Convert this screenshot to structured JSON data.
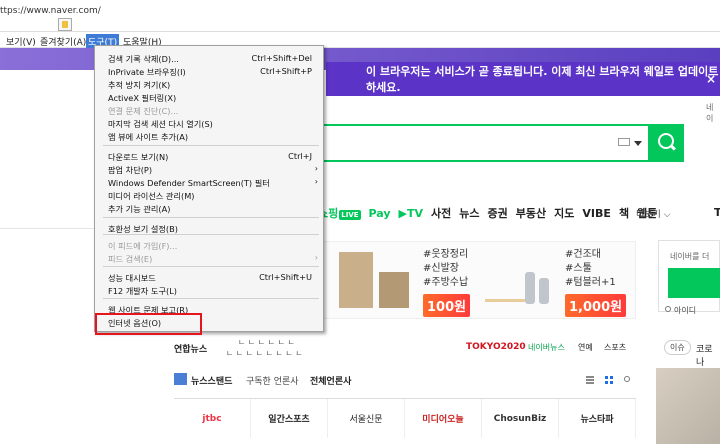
{
  "browser": {
    "url": "ttps://www.naver.com/",
    "menu": [
      "보기(V)",
      "즐겨찾기(A)",
      "도구(T)",
      "도움말(H)"
    ]
  },
  "banner": {
    "message": "이 브라우저는 서비스가 곧 종료됩니다. 이제 최신 브라우저 웨일로 업데이트하세요.",
    "close": "×"
  },
  "sublink": "네이",
  "nav": {
    "items": [
      "쇼핑",
      "Pay",
      "TV",
      "사전",
      "뉴스",
      "증권",
      "부동산",
      "지도",
      "VIBE",
      "책",
      "웹툰"
    ],
    "live": "LIVE",
    "more": "더보기 ⌵",
    "tail": "T"
  },
  "ad": {
    "tags1": [
      "#웃장정리",
      "#신발장",
      "#주방수납"
    ],
    "price1": "100원",
    "tags2": [
      "#건조대",
      "#스툴",
      "#텀블러+1"
    ],
    "price2": "1,000원"
  },
  "login": {
    "text": "네이버를 더",
    "id_link": "아이디"
  },
  "newsstrip": {
    "source": "연합뉴스",
    "headline1": "ㄴ ㄴ ㄴ ㄴ ㄴ ㄴ",
    "headline2": "ㄴ ㄴ ㄴ ㄴ ㄴ ㄴ ㄴ ㄴ",
    "tokyo": "TOKYO2020",
    "links": [
      "네이버뉴스",
      "연예",
      "스포츠"
    ],
    "pill": "이슈",
    "pill_text": "코로나"
  },
  "newsstand": {
    "title": "뉴스스탠드",
    "subscribed": "구독한 언론사",
    "all": "전체언론사",
    "press": [
      "jtbc",
      "일간스포츠",
      "서울신문",
      "미디어오늘",
      "ChosunBiz",
      "뉴스타파"
    ]
  },
  "dropdown": {
    "items": [
      {
        "label": "검색 기록 삭제(D)...",
        "shortcut": "Ctrl+Shift+Del",
        "disabled": false,
        "arrow": false
      },
      {
        "label": "InPrivate 브라우징(I)",
        "shortcut": "Ctrl+Shift+P",
        "disabled": false,
        "arrow": false
      },
      {
        "label": "추적 방지 켜기(K)",
        "shortcut": "",
        "disabled": false,
        "arrow": false
      },
      {
        "label": "ActiveX 필터링(X)",
        "shortcut": "",
        "disabled": false,
        "arrow": false
      },
      {
        "label": "연결 문제 진단(C)...",
        "shortcut": "",
        "disabled": true,
        "arrow": false
      },
      {
        "label": "마지막 검색 세션 다시 열기(S)",
        "shortcut": "",
        "disabled": false,
        "arrow": false
      },
      {
        "label": "앱 뷰에 사이트 추가(A)",
        "shortcut": "",
        "disabled": false,
        "arrow": false
      },
      {
        "label": "다운로드 보기(N)",
        "shortcut": "Ctrl+J",
        "disabled": false,
        "arrow": false
      },
      {
        "label": "팝업 차단(P)",
        "shortcut": "",
        "disabled": false,
        "arrow": true
      },
      {
        "label": "Windows Defender SmartScreen(T) 필터",
        "shortcut": "",
        "disabled": false,
        "arrow": true
      },
      {
        "label": "미디어 라이선스 관리(M)",
        "shortcut": "",
        "disabled": false,
        "arrow": false
      },
      {
        "label": "추가 기능 관리(A)",
        "shortcut": "",
        "disabled": false,
        "arrow": false
      },
      {
        "label": "호환성 보기 설정(B)",
        "shortcut": "",
        "disabled": false,
        "arrow": false
      },
      {
        "label": "이 피드에 가입(F)...",
        "shortcut": "",
        "disabled": true,
        "arrow": false
      },
      {
        "label": "피드 검색(E)",
        "shortcut": "",
        "disabled": true,
        "arrow": true
      },
      {
        "label": "성능 대시보드",
        "shortcut": "Ctrl+Shift+U",
        "disabled": false,
        "arrow": false
      },
      {
        "label": "F12 개발자 도구(L)",
        "shortcut": "",
        "disabled": false,
        "arrow": false
      },
      {
        "label": "웹 사이트 문제 보고(R)",
        "shortcut": "",
        "disabled": false,
        "arrow": false
      },
      {
        "label": "인터넷 옵션(O)",
        "shortcut": "",
        "disabled": false,
        "arrow": false
      }
    ]
  },
  "colors": {
    "naver_green": "#03c75a",
    "banner_purple": "#5b34c7",
    "menu_highlight": "#3d7bd6",
    "annotation_red": "#e5141e"
  }
}
